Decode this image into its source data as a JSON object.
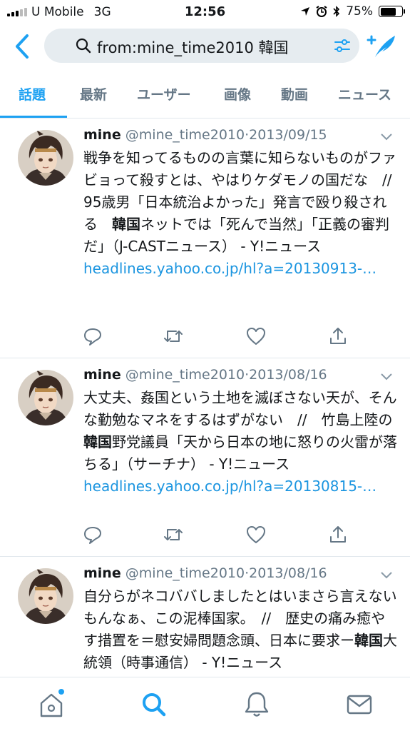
{
  "status_bar": {
    "carrier": "U Mobile",
    "network": "3G",
    "time": "12:56",
    "battery": "75%",
    "battery_level": 0.75
  },
  "search": {
    "query": "from:mine_time2010 韓国"
  },
  "tabs": [
    {
      "label": "話題",
      "active": true
    },
    {
      "label": "最新"
    },
    {
      "label": "ユーザー"
    },
    {
      "label": "画像"
    },
    {
      "label": "動画"
    },
    {
      "label": "ニュース"
    }
  ],
  "tweets": [
    {
      "name": "mine",
      "handle": "@mine_time2010",
      "sep": "·",
      "date": "2013/09/15",
      "text_before": "戦争を知ってるものの言葉に知らないものがファビョって殺すとは、やはりケダモノの国だな　//　95歳男「日本統治よかった」発言で殴り殺される　",
      "keyword": "韓国",
      "text_after": "ネットでは「死んで当然」「正義の審判だ」（J-CASTニュース） - Y!ニュース ",
      "link": "headlines.yahoo.co.jp/hl?a=20130913-…"
    },
    {
      "name": "mine",
      "handle": "@mine_time2010",
      "sep": "·",
      "date": "2013/08/16",
      "text_before": "大丈夫、姦国という土地を滅ぼさない天が、そんな勤勉なマネをするはずがない　//　竹島上陸の",
      "keyword": "韓国",
      "text_after": "野党議員「天から日本の地に怒りの火雷が落ちる」（サーチナ） - Y!ニュース ",
      "link": "headlines.yahoo.co.jp/hl?a=20130815-…"
    },
    {
      "name": "mine",
      "handle": "@mine_time2010",
      "sep": "·",
      "date": "2013/08/16",
      "text_before": "自分らがネコババしましたとはいまさら言えないもんなぁ、この泥棒国家。　//　歴史の痛み癒やす措置を＝慰安婦問題念頭、日本に要求ー",
      "keyword": "韓国",
      "text_after": "大統領（時事通信） - Y!ニュース ",
      "link": ""
    }
  ],
  "colors": {
    "accent": "#1da1f2",
    "link": "#1b95e0",
    "secondary_text": "#657786"
  },
  "icons": {
    "status": [
      "signal-icon",
      "location-icon",
      "alarm-icon",
      "bluetooth-icon",
      "battery-icon"
    ],
    "header": [
      "back-chevron-icon",
      "search-icon",
      "filter-icon",
      "compose-tweet-icon"
    ],
    "actions": [
      "reply-icon",
      "retweet-icon",
      "like-icon",
      "share-icon"
    ],
    "nav": [
      "home-icon",
      "search-icon",
      "notifications-icon",
      "messages-icon"
    ]
  }
}
